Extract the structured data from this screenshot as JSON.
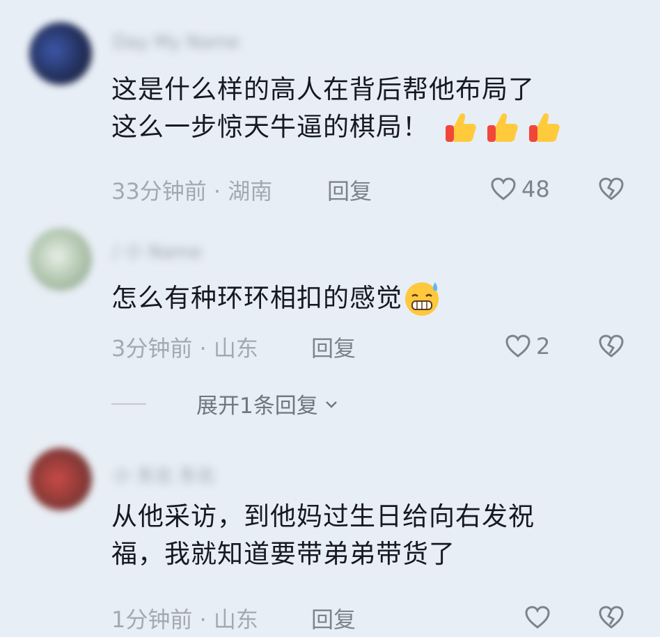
{
  "comments": [
    {
      "username": "Day My Name",
      "text_lines": [
        "这是什么样的高人在背后帮他布局了",
        "这么一步惊天牛逼的棋局！"
      ],
      "emoji": "thumbs-up-icon",
      "emoji_count": 3,
      "time_location": "33分钟前 · 湖南",
      "reply_label": "回复",
      "likes": "48"
    },
    {
      "username": "/ 小 Name",
      "text_lines": [
        "怎么有种环环相扣的感觉"
      ],
      "emoji": "grimacing-sweat-emoji-icon",
      "time_location": "3分钟前 · 山东",
      "reply_label": "回复",
      "likes": "2",
      "expand_label": "展开1条回复"
    },
    {
      "username": "小 东北 东北",
      "text_lines": [
        "从他采访，到他妈过生日给向右发祝",
        "福，我就知道要带弟弟带货了"
      ],
      "time_location": "1分钟前 · 山东",
      "reply_label": "回复",
      "likes": ""
    }
  ],
  "colors": {
    "background": "#e8eef5",
    "text": "#161823",
    "meta": "#a3a9b2",
    "action": "#7c838d"
  }
}
